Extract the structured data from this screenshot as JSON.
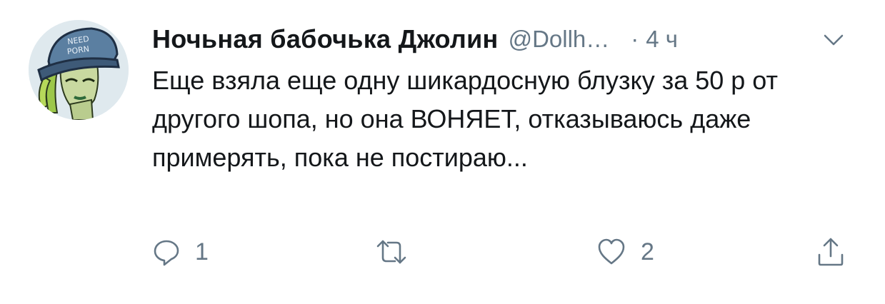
{
  "tweet": {
    "author": {
      "display_name": "Ночьная бабочька Джолин",
      "handle": "@Dollh…",
      "avatar_cap_text": [
        "NEED",
        "PORN"
      ]
    },
    "separator": "·",
    "time": "4 ч",
    "text": "Еще взяла еще одну шикардосную блузку за 50 р от другого шопа, но она ВОНЯЕТ, отказываюсь даже примерять, пока не постираю...",
    "actions": {
      "reply_count": "1",
      "retweet_count": "",
      "like_count": "2"
    }
  },
  "icons": {
    "reply": "reply-icon",
    "retweet": "retweet-icon",
    "like": "heart-icon",
    "share": "share-icon",
    "menu": "chevron-down-icon"
  },
  "colors": {
    "text": "#14171a",
    "secondary": "#657786",
    "avatar_bg": "#dfe9ee",
    "cap": "#5b7fa1"
  }
}
